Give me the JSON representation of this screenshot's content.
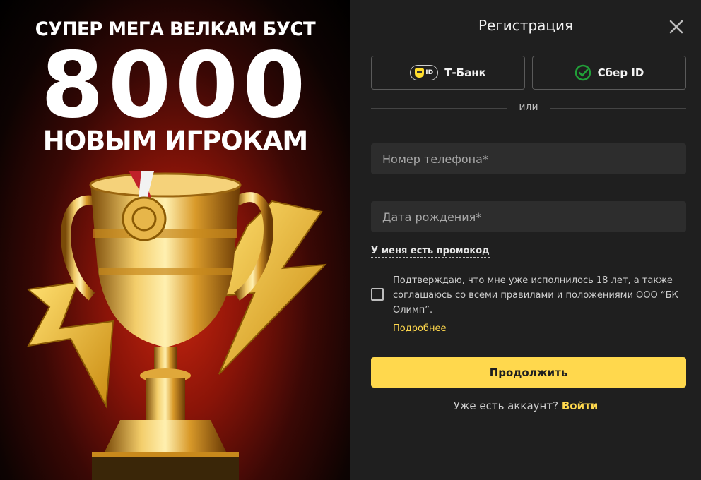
{
  "promo": {
    "line1": "СУПЕР МЕГА ВЕЛКАМ БУСТ",
    "amount": "8000",
    "line3": "НОВЫМ ИГРОКАМ"
  },
  "form": {
    "title": "Регистрация",
    "oauth": {
      "tbank_label": "Т-Банк",
      "tbank_badge": "ID",
      "sber_label": "Сбер ID"
    },
    "divider_text": "или",
    "phone_placeholder": "Номер телефона*",
    "birth_placeholder": "Дата рождения*",
    "promo_code_link": "У меня есть промокод",
    "consent_text": "Подтверждаю, что мне уже исполнилось 18 лет, а также соглашаюсь со всеми правилами и положениями ООО “БК Олимп”.",
    "consent_checked": false,
    "more_link": "Подробнее",
    "submit_label": "Продолжить",
    "have_account_text": "Уже есть аккаунт?",
    "login_link": "Войти"
  },
  "colors": {
    "accent": "#ffd84d",
    "panel_bg": "#1f1f1f",
    "field_bg": "#2d2d2d",
    "sber_green": "#21a038",
    "tbank_yellow": "#ffdd2d"
  },
  "icons": [
    "close-icon",
    "tbank-id-icon",
    "sber-check-icon",
    "trophy-image",
    "lightning-bolt-image"
  ]
}
